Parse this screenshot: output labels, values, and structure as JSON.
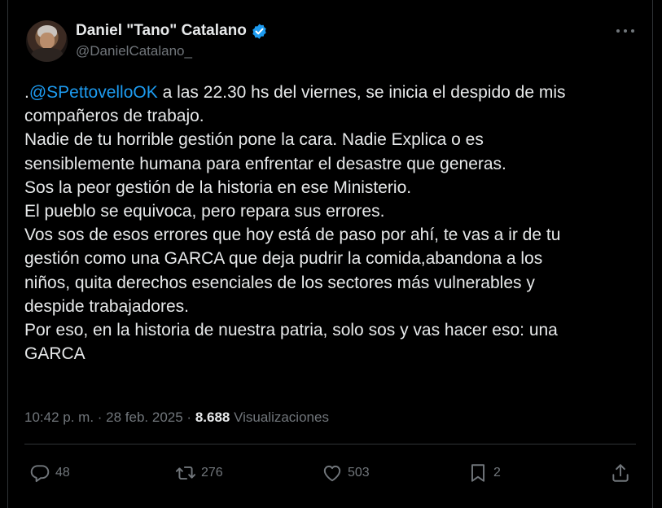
{
  "author": {
    "display_name": "Daniel \"Tano\" Catalano",
    "handle": "@DanielCatalano_",
    "verified": true,
    "verified_color": "#1d9bf0"
  },
  "tweet": {
    "mention_prefix": ".",
    "mention": "@SPettovelloOK",
    "lines": [
      " a las 22.30 hs del viernes, se inicia el despido de mis",
      "compañeros de trabajo.",
      "Nadie de tu horrible gestión pone la cara. Nadie Explica o es",
      "sensiblemente humana para enfrentar el desastre que generas.",
      "Sos la peor gestión de la historia en ese Ministerio.",
      "El pueblo se equivoca, pero repara sus errores.",
      "Vos sos de esos errores que hoy está de paso por ahí, te vas a ir de tu",
      "gestión como una GARCA que deja pudrir la comida,abandona a los",
      "niños, quita derechos esenciales de los sectores más vulnerables y",
      "despide trabajadores.",
      "Por eso, en la historia de nuestra patria, solo sos y vas hacer eso: una",
      "GARCA"
    ]
  },
  "meta": {
    "time": "10:42 p. m.",
    "separator": " · ",
    "date": "28 feb. 2025",
    "separator2": " · ",
    "views_count": "8.688",
    "views_label": " Visualizaciones"
  },
  "actions": {
    "replies": "48",
    "reposts": "276",
    "likes": "503",
    "bookmarks": "2"
  },
  "icons": {
    "more": "more-horizontal-icon",
    "reply": "reply-bubble-icon",
    "repost": "repost-arrows-icon",
    "like": "heart-icon",
    "bookmark": "bookmark-icon",
    "share": "share-upload-icon"
  },
  "colors": {
    "background": "#000000",
    "text": "#e7e9ea",
    "muted": "#71767b",
    "link": "#1d9bf0",
    "border": "#2f3336"
  }
}
